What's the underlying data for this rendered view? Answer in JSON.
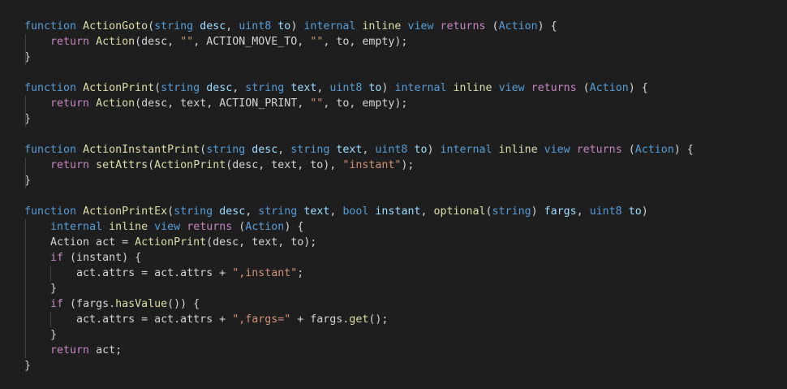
{
  "colors": {
    "background": "#1e1e1e",
    "keyword_blue": "#569cd6",
    "keyword_control": "#c586c0",
    "function_name": "#dcdcaa",
    "type": "#4ec9b0",
    "variable": "#9cdcfe",
    "string": "#ce9178",
    "plain": "#d4d4d4",
    "indent_guide": "#404040"
  },
  "code_lines": [
    [
      [
        "kw",
        "function"
      ],
      [
        "p",
        " "
      ],
      [
        "fn",
        "ActionGoto"
      ],
      [
        "p",
        "("
      ],
      [
        "kw",
        "string"
      ],
      [
        "p",
        " "
      ],
      [
        "var",
        "desc"
      ],
      [
        "p",
        ", "
      ],
      [
        "kw",
        "uint8"
      ],
      [
        "p",
        " "
      ],
      [
        "var",
        "to"
      ],
      [
        "p",
        ") "
      ],
      [
        "kw",
        "internal"
      ],
      [
        "p",
        " "
      ],
      [
        "inline",
        "inline"
      ],
      [
        "p",
        " "
      ],
      [
        "kw",
        "view"
      ],
      [
        "p",
        " "
      ],
      [
        "kw2",
        "returns"
      ],
      [
        "p",
        " ("
      ],
      [
        "kw",
        "Action"
      ],
      [
        "p",
        ") {"
      ]
    ],
    [
      [
        "p",
        "    "
      ],
      [
        "kw2",
        "return"
      ],
      [
        "p",
        " "
      ],
      [
        "fn",
        "Action"
      ],
      [
        "p",
        "(desc, "
      ],
      [
        "str",
        "\"\""
      ],
      [
        "p",
        ", ACTION_MOVE_TO, "
      ],
      [
        "str",
        "\"\""
      ],
      [
        "p",
        ", to, empty);"
      ]
    ],
    [
      [
        "p",
        "}"
      ]
    ],
    [],
    [
      [
        "kw",
        "function"
      ],
      [
        "p",
        " "
      ],
      [
        "fn",
        "ActionPrint"
      ],
      [
        "p",
        "("
      ],
      [
        "kw",
        "string"
      ],
      [
        "p",
        " "
      ],
      [
        "var",
        "desc"
      ],
      [
        "p",
        ", "
      ],
      [
        "kw",
        "string"
      ],
      [
        "p",
        " "
      ],
      [
        "var",
        "text"
      ],
      [
        "p",
        ", "
      ],
      [
        "kw",
        "uint8"
      ],
      [
        "p",
        " "
      ],
      [
        "var",
        "to"
      ],
      [
        "p",
        ") "
      ],
      [
        "kw",
        "internal"
      ],
      [
        "p",
        " "
      ],
      [
        "inline",
        "inline"
      ],
      [
        "p",
        " "
      ],
      [
        "kw",
        "view"
      ],
      [
        "p",
        " "
      ],
      [
        "kw2",
        "returns"
      ],
      [
        "p",
        " ("
      ],
      [
        "kw",
        "Action"
      ],
      [
        "p",
        ") {"
      ]
    ],
    [
      [
        "p",
        "    "
      ],
      [
        "kw2",
        "return"
      ],
      [
        "p",
        " "
      ],
      [
        "fn",
        "Action"
      ],
      [
        "p",
        "(desc, text, ACTION_PRINT, "
      ],
      [
        "str",
        "\"\""
      ],
      [
        "p",
        ", to, empty);"
      ]
    ],
    [
      [
        "p",
        "}"
      ]
    ],
    [],
    [
      [
        "kw",
        "function"
      ],
      [
        "p",
        " "
      ],
      [
        "fn",
        "ActionInstantPrint"
      ],
      [
        "p",
        "("
      ],
      [
        "kw",
        "string"
      ],
      [
        "p",
        " "
      ],
      [
        "var",
        "desc"
      ],
      [
        "p",
        ", "
      ],
      [
        "kw",
        "string"
      ],
      [
        "p",
        " "
      ],
      [
        "var",
        "text"
      ],
      [
        "p",
        ", "
      ],
      [
        "kw",
        "uint8"
      ],
      [
        "p",
        " "
      ],
      [
        "var",
        "to"
      ],
      [
        "p",
        ") "
      ],
      [
        "kw",
        "internal"
      ],
      [
        "p",
        " "
      ],
      [
        "inline",
        "inline"
      ],
      [
        "p",
        " "
      ],
      [
        "kw",
        "view"
      ],
      [
        "p",
        " "
      ],
      [
        "kw2",
        "returns"
      ],
      [
        "p",
        " ("
      ],
      [
        "kw",
        "Action"
      ],
      [
        "p",
        ") {"
      ]
    ],
    [
      [
        "p",
        "    "
      ],
      [
        "kw2",
        "return"
      ],
      [
        "p",
        " "
      ],
      [
        "fn",
        "setAttrs"
      ],
      [
        "p",
        "("
      ],
      [
        "fn",
        "ActionPrint"
      ],
      [
        "p",
        "(desc, text, to), "
      ],
      [
        "str",
        "\"instant\""
      ],
      [
        "p",
        ");"
      ]
    ],
    [
      [
        "p",
        "}"
      ]
    ],
    [],
    [
      [
        "kw",
        "function"
      ],
      [
        "p",
        " "
      ],
      [
        "fn",
        "ActionPrintEx"
      ],
      [
        "p",
        "("
      ],
      [
        "kw",
        "string"
      ],
      [
        "p",
        " "
      ],
      [
        "var",
        "desc"
      ],
      [
        "p",
        ", "
      ],
      [
        "kw",
        "string"
      ],
      [
        "p",
        " "
      ],
      [
        "var",
        "text"
      ],
      [
        "p",
        ", "
      ],
      [
        "kw",
        "bool"
      ],
      [
        "p",
        " "
      ],
      [
        "var",
        "instant"
      ],
      [
        "p",
        ", "
      ],
      [
        "inline",
        "optional"
      ],
      [
        "p",
        "("
      ],
      [
        "kw",
        "string"
      ],
      [
        "p",
        ") "
      ],
      [
        "var",
        "fargs"
      ],
      [
        "p",
        ", "
      ],
      [
        "kw",
        "uint8"
      ],
      [
        "p",
        " "
      ],
      [
        "var",
        "to"
      ],
      [
        "p",
        ")"
      ]
    ],
    [
      [
        "p",
        "    "
      ],
      [
        "kw",
        "internal"
      ],
      [
        "p",
        " "
      ],
      [
        "inline",
        "inline"
      ],
      [
        "p",
        " "
      ],
      [
        "kw",
        "view"
      ],
      [
        "p",
        " "
      ],
      [
        "kw2",
        "returns"
      ],
      [
        "p",
        " ("
      ],
      [
        "kw",
        "Action"
      ],
      [
        "p",
        ") {"
      ]
    ],
    [
      [
        "p",
        "    Action act = "
      ],
      [
        "fn",
        "ActionPrint"
      ],
      [
        "p",
        "(desc, text, to);"
      ]
    ],
    [
      [
        "p",
        "    "
      ],
      [
        "kw2",
        "if"
      ],
      [
        "p",
        " (instant) {"
      ]
    ],
    [
      [
        "p",
        "        act.attrs = act.attrs + "
      ],
      [
        "str",
        "\",instant\""
      ],
      [
        "p",
        ";"
      ]
    ],
    [
      [
        "p",
        "    }"
      ]
    ],
    [
      [
        "p",
        "    "
      ],
      [
        "kw2",
        "if"
      ],
      [
        "p",
        " (fargs."
      ],
      [
        "fn",
        "hasValue"
      ],
      [
        "p",
        "()) {"
      ]
    ],
    [
      [
        "p",
        "        act.attrs = act.attrs + "
      ],
      [
        "str",
        "\",fargs=\""
      ],
      [
        "p",
        " + fargs."
      ],
      [
        "fn",
        "get"
      ],
      [
        "p",
        "();"
      ]
    ],
    [
      [
        "p",
        "    }"
      ]
    ],
    [
      [
        "p",
        "    "
      ],
      [
        "kw2",
        "return"
      ],
      [
        "p",
        " act;"
      ]
    ],
    [
      [
        "p",
        "}"
      ]
    ]
  ]
}
